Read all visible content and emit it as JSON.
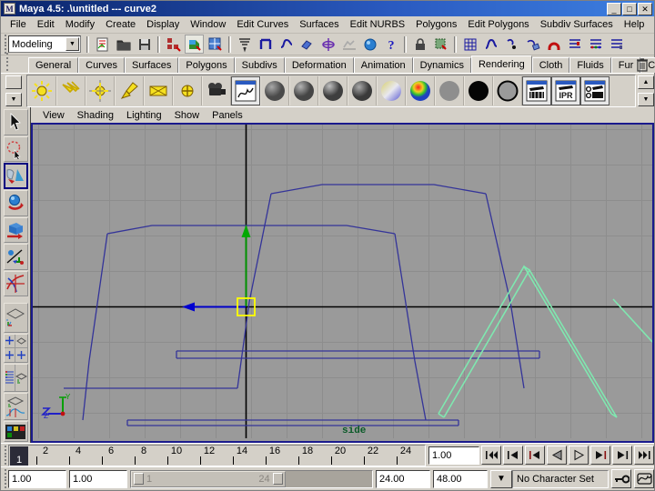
{
  "window": {
    "title": "Maya 4.5: .\\untitled  ---  curve2",
    "app_icon": "maya-icon",
    "minimize_label": "_",
    "maximize_label": "□",
    "close_label": "✕"
  },
  "menubar": {
    "items": [
      {
        "label": "File",
        "name": "menu-file"
      },
      {
        "label": "Edit",
        "name": "menu-edit"
      },
      {
        "label": "Modify",
        "name": "menu-modify"
      },
      {
        "label": "Create",
        "name": "menu-create"
      },
      {
        "label": "Display",
        "name": "menu-display"
      },
      {
        "label": "Window",
        "name": "menu-window"
      },
      {
        "label": "Edit Curves",
        "name": "menu-edit-curves"
      },
      {
        "label": "Surfaces",
        "name": "menu-surfaces"
      },
      {
        "label": "Edit NURBS",
        "name": "menu-edit-nurbs"
      },
      {
        "label": "Polygons",
        "name": "menu-polygons"
      },
      {
        "label": "Edit Polygons",
        "name": "menu-edit-polygons"
      },
      {
        "label": "Subdiv Surfaces",
        "name": "menu-subdiv-surfaces"
      },
      {
        "label": "Help",
        "name": "menu-help"
      }
    ]
  },
  "toolbar": {
    "menuset": "Modeling",
    "menuset_arrow": "▼",
    "icons": [
      "new-scene-icon",
      "open-scene-icon",
      "save-scene-icon",
      "select-by-hierarchy-icon",
      "select-by-object-icon",
      "select-by-component-icon",
      "snap-to-grid-icon",
      "snap-to-point-icon",
      "snap-to-curve-icon",
      "snap-to-surface-icon",
      "snap-to-view-plane-icon",
      "make-live-icon",
      "construction-history-icon",
      "render-help-icon",
      "render-current-frame-icon",
      "ipr-render-icon",
      "show-hide-grid-icon",
      "curve-editor-icon",
      "point-snap-icon",
      "magnet-icon",
      "attribute-editor-icon",
      "tool-settings-icon",
      "channel-box-icon"
    ]
  },
  "shelf": {
    "tabs": [
      {
        "label": "General",
        "active": false
      },
      {
        "label": "Curves",
        "active": false
      },
      {
        "label": "Surfaces",
        "active": false
      },
      {
        "label": "Polygons",
        "active": false
      },
      {
        "label": "Subdivs",
        "active": false
      },
      {
        "label": "Deformation",
        "active": false
      },
      {
        "label": "Animation",
        "active": false
      },
      {
        "label": "Dynamics",
        "active": false
      },
      {
        "label": "Rendering",
        "active": true
      },
      {
        "label": "Cloth",
        "active": false
      },
      {
        "label": "Fluids",
        "active": false
      },
      {
        "label": "Fur",
        "active": false
      },
      {
        "label": "Custom",
        "active": false
      }
    ],
    "trash_icon": "trash-icon",
    "up_arrow": "▲",
    "down_arrow": "▼",
    "items": [
      {
        "name": "point-light-icon",
        "kind": "sun"
      },
      {
        "name": "directional-light-icon",
        "kind": "dirlight"
      },
      {
        "name": "ambient-light-icon",
        "kind": "ambient"
      },
      {
        "name": "spot-light-icon",
        "kind": "spot"
      },
      {
        "name": "area-light-icon",
        "kind": "area"
      },
      {
        "name": "volume-light-icon",
        "kind": "volume"
      },
      {
        "name": "camera-icon",
        "kind": "camera"
      },
      {
        "name": "render-view-icon",
        "kind": "window"
      },
      {
        "name": "lambert-shader-icon",
        "kind": "sphere",
        "color": "#6e6e6e"
      },
      {
        "name": "blinn-shader-icon",
        "kind": "sphere",
        "color": "#707070"
      },
      {
        "name": "phong-shader-icon",
        "kind": "sphere",
        "color": "#6a6a6a"
      },
      {
        "name": "anisotropic-shader-icon",
        "kind": "sphere",
        "color": "#686868"
      },
      {
        "name": "layered-shader-icon",
        "kind": "sphere-multi"
      },
      {
        "name": "ramp-shader-icon",
        "kind": "sphere-ramp"
      },
      {
        "name": "surface-shader-icon",
        "kind": "sphere-flat",
        "color": "#8c8c8c"
      },
      {
        "name": "use-background-icon",
        "kind": "circle-black"
      },
      {
        "name": "shading-map-icon",
        "kind": "circle-white"
      },
      {
        "name": "render-current-frame-icon",
        "kind": "clapper"
      },
      {
        "name": "ipr-render-icon",
        "kind": "clapper-ipr"
      },
      {
        "name": "render-globals-icon",
        "kind": "clapper-globals"
      }
    ]
  },
  "toolbox": {
    "tools": [
      {
        "name": "select-tool",
        "active": false
      },
      {
        "name": "lasso-tool",
        "active": false
      },
      {
        "name": "paint-selection-tool",
        "active": true
      },
      {
        "name": "move-tool",
        "active": false
      },
      {
        "name": "rotate-tool",
        "active": false
      },
      {
        "name": "scale-tool",
        "active": false
      },
      {
        "name": "universal-manipulator-tool",
        "active": false
      },
      {
        "name": "soft-modification-tool",
        "active": false
      }
    ],
    "layouts": [
      {
        "name": "layout-single-perspective"
      },
      {
        "name": "layout-four-view"
      },
      {
        "name": "layout-outliner-persp"
      },
      {
        "name": "layout-persp-graph"
      },
      {
        "name": "layout-hypershade-persp"
      }
    ]
  },
  "viewport": {
    "menus": [
      {
        "label": "View",
        "name": "vp-menu-view"
      },
      {
        "label": "Shading",
        "name": "vp-menu-shading"
      },
      {
        "label": "Lighting",
        "name": "vp-menu-lighting"
      },
      {
        "label": "Show",
        "name": "vp-menu-show"
      },
      {
        "label": "Panels",
        "name": "vp-menu-panels"
      }
    ],
    "camera_label": "side",
    "axis_y_label": "Y",
    "axis_z_label": "Z",
    "background_color": "#9a9a9a",
    "grid_color": "#8c8c8c",
    "axis_line_color": "#000000",
    "curve_color": "#3a3a8c",
    "selected_curve_color": "#7fe8b0",
    "manipulator_handle_color": "#ffff00",
    "manipulator_y_color": "#00a000",
    "manipulator_z_color": "#0000c0"
  },
  "timeslider": {
    "current_frame": "1",
    "tick_labels": [
      "2",
      "4",
      "6",
      "8",
      "10",
      "12",
      "14",
      "16",
      "18",
      "20",
      "22",
      "24"
    ],
    "current_time_value": "1.00",
    "playback_buttons": [
      {
        "name": "go-to-start-button",
        "glyph": "go-to-start"
      },
      {
        "name": "step-back-key-button",
        "glyph": "step-back-key"
      },
      {
        "name": "step-back-frame-button",
        "glyph": "step-back-frame"
      },
      {
        "name": "play-backwards-button",
        "glyph": "play-back"
      },
      {
        "name": "play-forwards-button",
        "glyph": "play-fwd"
      },
      {
        "name": "step-forward-frame-button",
        "glyph": "step-fwd-frame"
      },
      {
        "name": "step-forward-key-button",
        "glyph": "step-fwd-key"
      },
      {
        "name": "go-to-end-button",
        "glyph": "go-to-end"
      }
    ]
  },
  "rangeslider": {
    "anim_start": "1.00",
    "range_start": "1.00",
    "range_bar_start_label": "1",
    "range_bar_end_label": "24",
    "range_end": "24.00",
    "anim_end": "48.00",
    "character_set": "No Character Set",
    "character_dropdown_arrow": "▼",
    "auto_key_icon": "key-icon",
    "animation_prefs_icon": "animation-preferences-icon"
  }
}
